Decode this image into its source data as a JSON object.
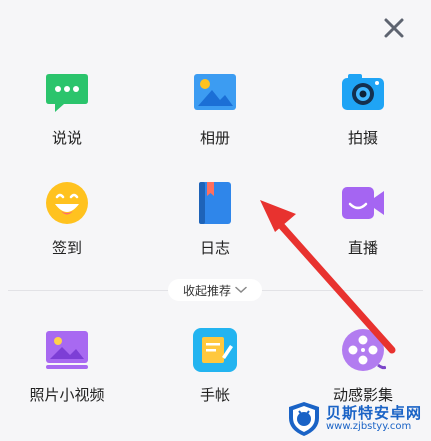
{
  "close": {
    "icon": "close-icon"
  },
  "items": [
    {
      "label": "说说",
      "icon": "chat-bubble-icon",
      "color": "#2bc46c"
    },
    {
      "label": "相册",
      "icon": "photo-album-icon",
      "color": "#3c9cf2"
    },
    {
      "label": "拍摄",
      "icon": "camera-icon",
      "color": "#1fa4f5"
    },
    {
      "label": "签到",
      "icon": "smiley-face-icon",
      "color": "#ffc21f"
    },
    {
      "label": "日志",
      "icon": "journal-book-icon",
      "color": "#2f86ea"
    },
    {
      "label": "直播",
      "icon": "video-camera-icon",
      "color": "#a565f2"
    },
    {
      "label": "照片小视频",
      "icon": "photo-video-icon",
      "color": "#a869f1"
    },
    {
      "label": "手帐",
      "icon": "notebook-icon",
      "color": "#23b4f0"
    },
    {
      "label": "动感影集",
      "icon": "film-reel-icon",
      "color": "#b27cf0"
    }
  ],
  "recommend": {
    "label": "收起推荐",
    "icon": "chevron-down-icon"
  },
  "watermark": {
    "title": "贝斯特安卓网",
    "url": "www.zjbstyy.com"
  },
  "annotation": {
    "icon": "red-arrow-icon",
    "color": "#e8322f"
  }
}
